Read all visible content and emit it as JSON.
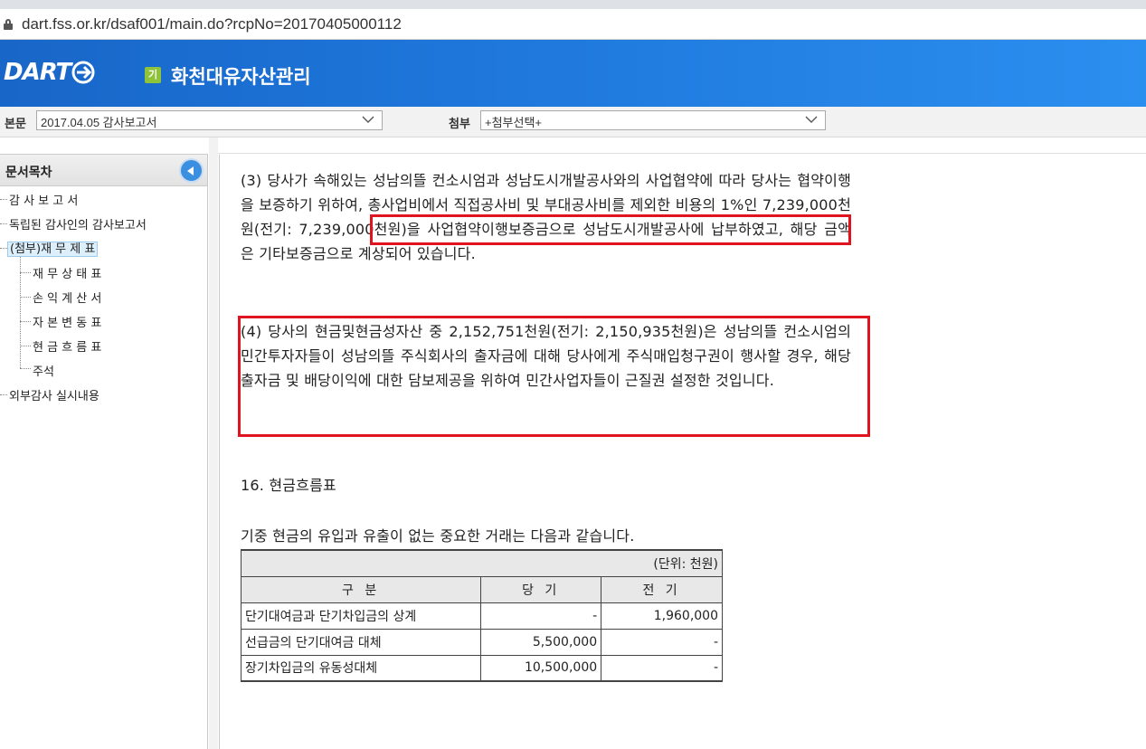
{
  "browser": {
    "url": "dart.fss.or.kr/dsaf001/main.do?rcpNo=20170405000112"
  },
  "header": {
    "logo": "DART",
    "corp_badge": "기",
    "corp_name": "화천대유자산관리"
  },
  "selectors": {
    "main_label": "본문",
    "main_value": "2017.04.05  감사보고서",
    "attach_label": "첨부",
    "attach_value": "+첨부선택+"
  },
  "sidebar": {
    "title": "문서목차",
    "items": [
      "감 사 보 고 서",
      "독립된 감사인의 감사보고서",
      "(첨부)재 무 제 표",
      "재 무 상 태 표",
      "손 익 계 산 서",
      "자 본 변 동 표",
      "현 금 흐 름 표",
      "주석",
      "외부감사 실시내용"
    ]
  },
  "content": {
    "para3": "(3) 당사가 속해있는 성남의뜰 컨소시엄과 성남도시개발공사와의 사업협약에 따라 당사는 협약이행을 보증하기 위하여, 총사업비에서 직접공사비 및 부대공사비를 제외한 비용의 1%인 7,239,000천원(전기: 7,239,000천원)을 사업협약이행보증금으로 성남도시개발공사에 납부하였고, 해당 금액은 기타보증금으로 계상되어 있습니다.",
    "para4": "(4) 당사의 현금및현금성자산 중 2,152,751천원(전기: 2,150,935천원)은 성남의뜰 컨소시엄의 민간투자자들이 성남의뜰 주식회사의 출자금에 대해 당사에게 주식매입청구권이 행사할 경우, 해당 출자금 및 배당이익에 대한 담보제공을 위하여 민간사업자들이 근질권 설정한 것입니다.",
    "section16": "16. 현금흐름표",
    "intro": "기중 현금의 유입과 유출이 없는 중요한 거래는 다음과 같습니다.",
    "table": {
      "unit": "(단위: 천원)",
      "headers": [
        "구   분",
        "당   기",
        "전   기"
      ],
      "rows": [
        [
          "단기대여금과 단기차입금의 상계",
          "-",
          "1,960,000"
        ],
        [
          "선급금의 단기대여금 대체",
          "5,500,000",
          "-"
        ],
        [
          "장기차입금의 유동성대체",
          "10,500,000",
          "-"
        ]
      ]
    }
  }
}
